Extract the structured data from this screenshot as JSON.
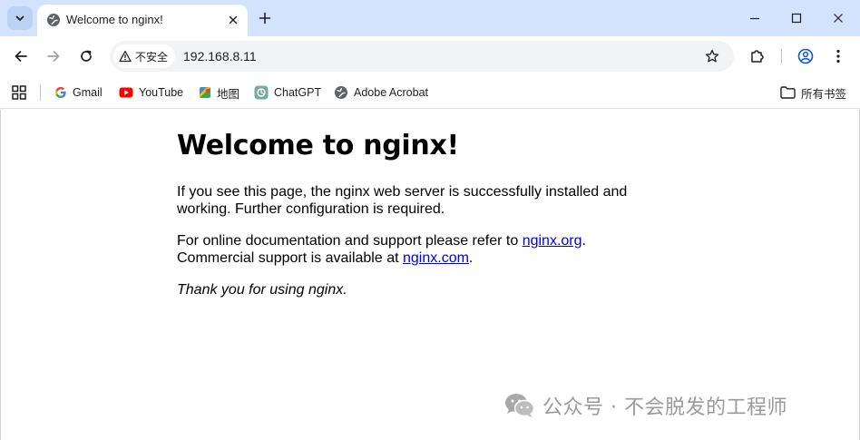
{
  "browser": {
    "tab": {
      "title": "Welcome to nginx!"
    },
    "omnibox": {
      "security_label": "不安全",
      "url": "192.168.8.11"
    },
    "bookmarks": [
      {
        "label": "Gmail"
      },
      {
        "label": "YouTube"
      },
      {
        "label": "地图"
      },
      {
        "label": "ChatGPT"
      },
      {
        "label": "Adobe Acrobat"
      }
    ],
    "all_bookmarks_label": "所有书签"
  },
  "page": {
    "heading": "Welcome to nginx!",
    "para1": "If you see this page, the nginx web server is successfully installed and working. Further configuration is required.",
    "para2_prefix": "For online documentation and support please refer to ",
    "link_org": "nginx.org",
    "para2_mid": ".",
    "para2_line2": "Commercial support is available at ",
    "link_com": "nginx.com",
    "para2_suffix": ".",
    "thanks": "Thank you for using nginx."
  },
  "watermark": {
    "text": "公众号 · 不会脱发的工程师"
  },
  "colors": {
    "titlebar": "#d3e3fd",
    "omnibox": "#f1f3f4",
    "link": "#0000ee"
  }
}
